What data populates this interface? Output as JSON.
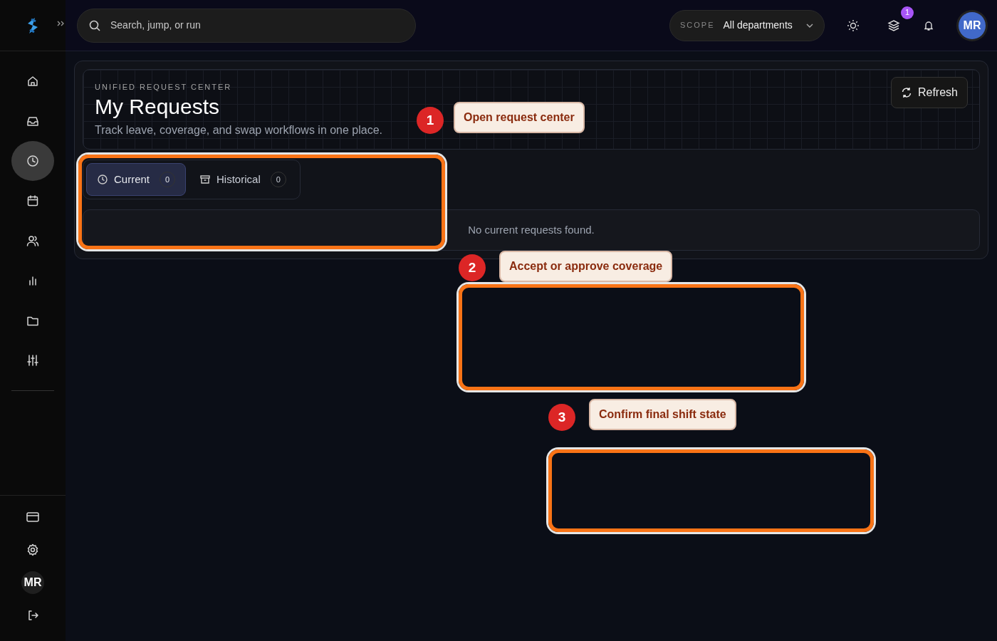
{
  "topbar": {
    "search": {
      "placeholder": "Search, jump, or run"
    },
    "scope": {
      "label": "SCOPE",
      "value": "All departments"
    },
    "updates_badge": "1",
    "avatar": "MR"
  },
  "sidebar": {
    "items": [
      {
        "selected": false
      },
      {
        "selected": false
      },
      {
        "selected": true
      },
      {
        "selected": false
      },
      {
        "selected": false
      },
      {
        "selected": false
      },
      {
        "selected": false
      },
      {
        "selected": false
      }
    ],
    "avatar": "MR"
  },
  "header": {
    "eyebrow": "UNIFIED REQUEST CENTER",
    "title": "My Requests",
    "subtitle": "Track leave, coverage, and swap workflows in one place.",
    "refresh": "Refresh"
  },
  "tabs": [
    {
      "label": "Current",
      "count": "0",
      "selected": true
    },
    {
      "label": "Historical",
      "count": "0",
      "selected": false
    }
  ],
  "empty_message": "No current requests found.",
  "tour": [
    {
      "number": "1",
      "label": "Open request center"
    },
    {
      "number": "2",
      "label": "Accept or approve coverage"
    },
    {
      "number": "3",
      "label": "Confirm final shift state"
    }
  ]
}
